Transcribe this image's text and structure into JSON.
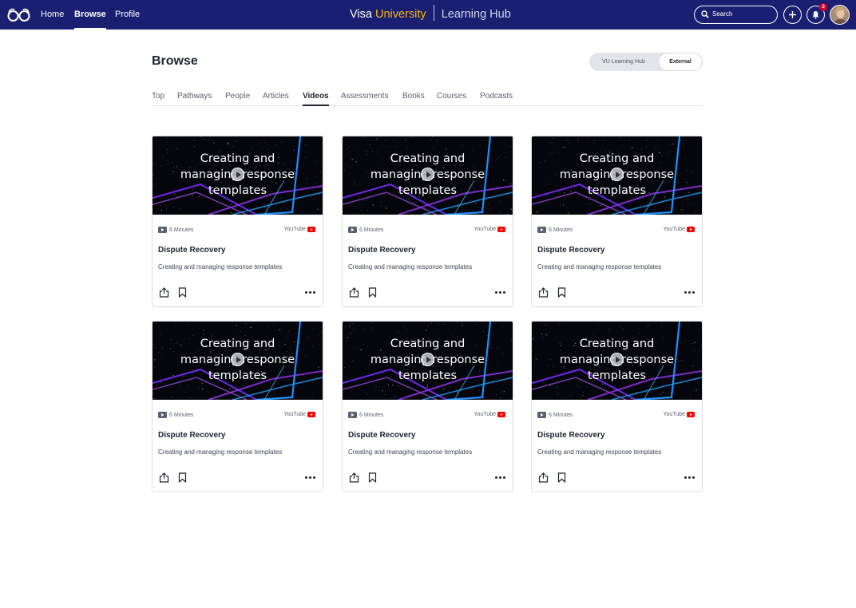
{
  "nav": {
    "logo": "visa-university-glasses-logo",
    "links": [
      "Home",
      "Browse",
      "Profile"
    ],
    "active": "Browse",
    "brand": {
      "part1": "Visa",
      "part2": "University",
      "part3": "Learning Hub"
    },
    "search_placeholder": "Search",
    "notification_count": "3",
    "colors": {
      "bar": "#1a1f71",
      "brand_gold": "#f7b600",
      "badge": "#d6002a"
    }
  },
  "page": {
    "title": "Browse",
    "toggle": {
      "options": [
        "VU Learning Hub",
        "External"
      ],
      "selected": "External"
    },
    "tabs": [
      "Top",
      "Pathways",
      "People",
      "Articles",
      "Videos",
      "Assessments",
      "Books",
      "Courses",
      "Podcasts"
    ],
    "active_tab": "Videos"
  },
  "cards": [
    {
      "thumb_line1": "Creating and",
      "thumb_line2": "managing response",
      "thumb_line3": "templates",
      "duration": "6 Minutes",
      "source": "YouTube",
      "title": "Dispute Recovery",
      "description": "Creating and managing response templates"
    },
    {
      "thumb_line1": "Creating and",
      "thumb_line2": "managing response",
      "thumb_line3": "templates",
      "duration": "6 Minutes",
      "source": "YouTube",
      "title": "Dispute Recovery",
      "description": "Creating and managing response templates"
    },
    {
      "thumb_line1": "Creating and",
      "thumb_line2": "managing response",
      "thumb_line3": "templates",
      "duration": "6 Minutes",
      "source": "YouTube",
      "title": "Dispute Recovery",
      "description": "Creating and managing response templates"
    },
    {
      "thumb_line1": "Creating and",
      "thumb_line2": "managing response",
      "thumb_line3": "templates",
      "duration": "6 Minutes",
      "source": "YouTube",
      "title": "Dispute Recovery",
      "description": "Creating and managing response templates"
    },
    {
      "thumb_line1": "Creating and",
      "thumb_line2": "managing response",
      "thumb_line3": "templates",
      "duration": "6 Minutes",
      "source": "YouTube",
      "title": "Dispute Recovery",
      "description": "Creating and managing response templates"
    },
    {
      "thumb_line1": "Creating and",
      "thumb_line2": "managing response",
      "thumb_line3": "templates",
      "duration": "6 Minutes",
      "source": "YouTube",
      "title": "Dispute Recovery",
      "description": "Creating and managing response templates"
    }
  ]
}
